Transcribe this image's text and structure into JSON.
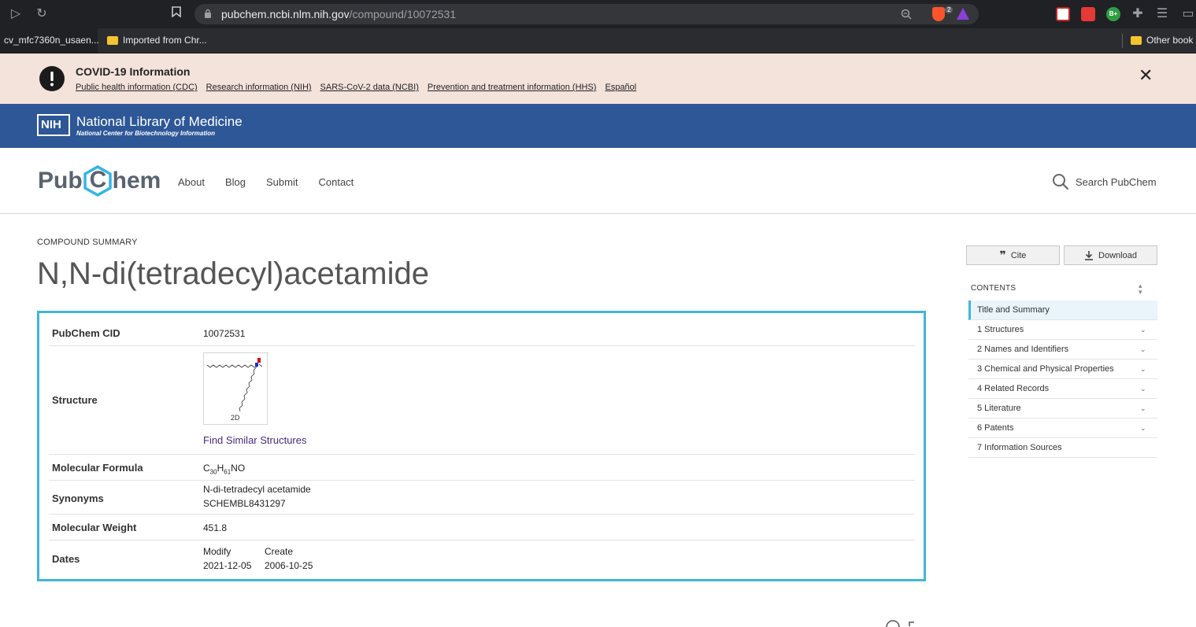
{
  "browser": {
    "url_host": "pubchem.ncbi.nlm.nih.gov",
    "url_path": "/compound/10072531",
    "bookmarks": [
      "cv_mfc7360n_usaen...",
      "Imported from Chr...",
      "Other book"
    ],
    "shield_badge": "2",
    "ext_badge": "B+"
  },
  "covid": {
    "title": "COVID-19 Information",
    "links": [
      "Public health information (CDC)",
      "Research information (NIH)",
      "SARS-CoV-2 data (NCBI)",
      "Prevention and treatment information (HHS)",
      "Español"
    ],
    "close": "✕"
  },
  "nlm": {
    "logo": "NIH",
    "title": "National Library of Medicine",
    "subtitle": "National Center for Biotechnology Information"
  },
  "pubchem": {
    "logo_left": "Pub",
    "logo_mid": "C",
    "logo_right": "hem",
    "nav": [
      "About",
      "Blog",
      "Submit",
      "Contact"
    ],
    "search_label": "Search PubChem"
  },
  "compound": {
    "kind": "COMPOUND SUMMARY",
    "title": "N,N-di(tetradecyl)acetamide",
    "rows": {
      "cid_label": "PubChem CID",
      "cid_value": "10072531",
      "structure_label": "Structure",
      "structure_tag": "2D",
      "find_similar": "Find Similar Structures",
      "formula_label": "Molecular Formula",
      "formula_c": "C",
      "formula_c_n": "30",
      "formula_h": "H",
      "formula_h_n": "61",
      "formula_rest": "NO",
      "synonyms_label": "Synonyms",
      "synonym_1": "N-di-tetradecyl acetamide",
      "synonym_2": "SCHEMBL8431297",
      "weight_label": "Molecular Weight",
      "weight_value": "451.8",
      "dates_label": "Dates",
      "modify_label": "Modify",
      "modify_value": "2021-12-05",
      "create_label": "Create",
      "create_value": "2006-10-25"
    }
  },
  "sidebar": {
    "cite": "Cite",
    "download": "Download",
    "contents_label": "CONTENTS",
    "items": [
      "Title and Summary",
      "1 Structures",
      "2 Names and Identifiers",
      "3 Chemical and Physical Properties",
      "4 Related Records",
      "5 Literature",
      "6 Patents",
      "7 Information Sources"
    ]
  },
  "colors": {
    "accent": "#40b6d8",
    "nlm_blue": "#2d5797",
    "banner": "#f4e3db"
  }
}
